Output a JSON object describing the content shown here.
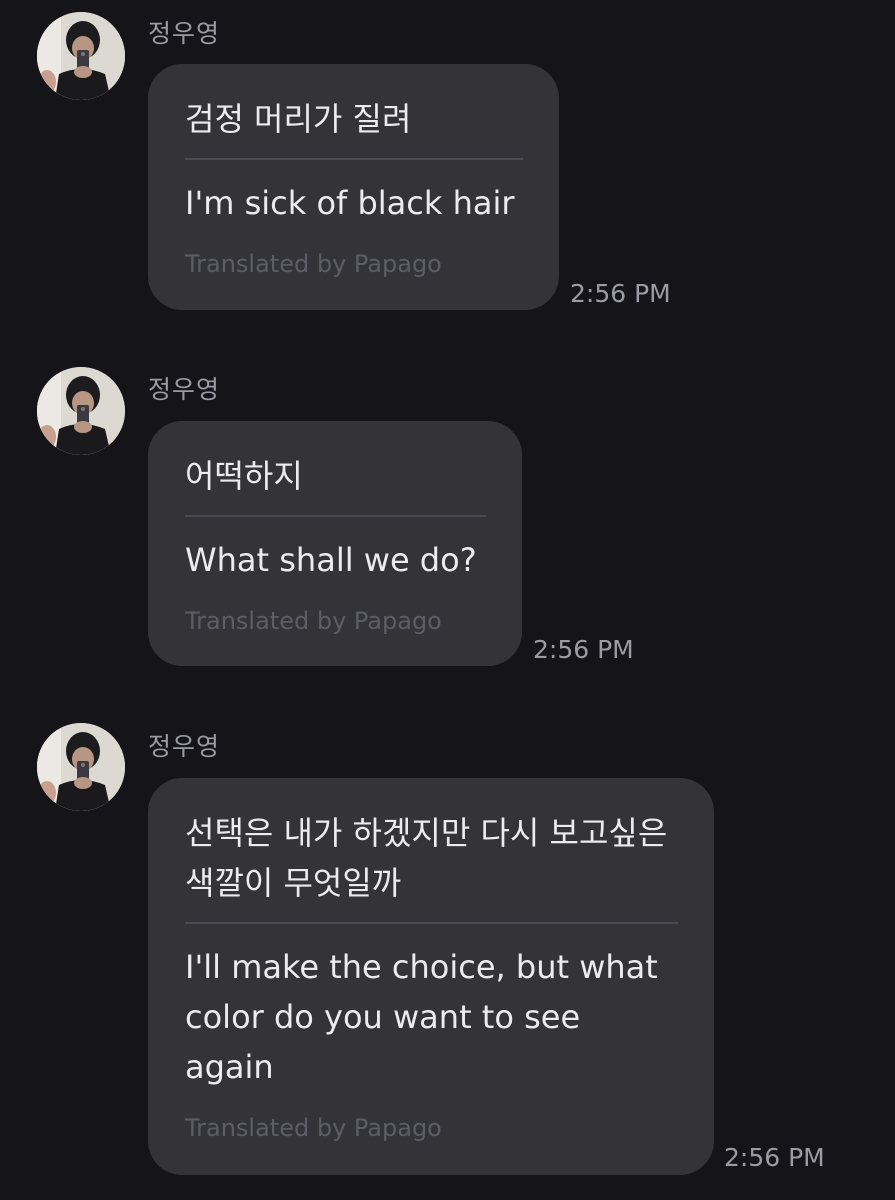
{
  "messages": [
    {
      "sender": "정우영",
      "original": "검정 머리가 질려",
      "translation": "I'm sick of black hair",
      "credit": "Translated by Papago",
      "time": "2:56 PM"
    },
    {
      "sender": "정우영",
      "original": "어떡하지",
      "translation": "What shall we do?",
      "credit": "Translated by Papago",
      "time": "2:56 PM"
    },
    {
      "sender": "정우영",
      "original": "선택은 내가 하겠지만 다시 보고싶은 색깔이 무엇일까",
      "translation": "I'll make the choice, but what color do you want to see again",
      "credit": "Translated by Papago",
      "time": "2:56 PM"
    }
  ],
  "colors": {
    "background": "#151519",
    "bubble": "#333338",
    "divider": "#4a4a52",
    "credit_text": "#5d5d66",
    "meta_text": "#9b9ba3"
  },
  "icons": {
    "avatar": "profile-photo"
  }
}
